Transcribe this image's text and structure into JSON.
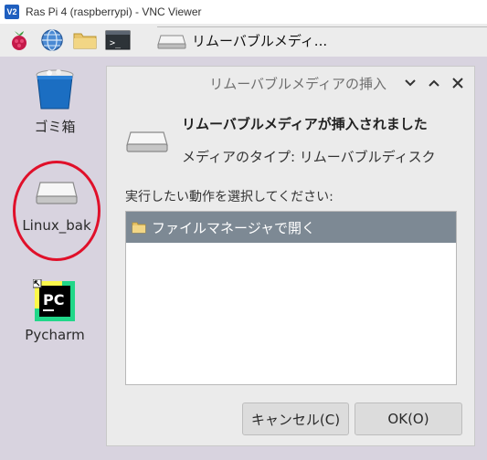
{
  "vnc": {
    "logo_text": "V2",
    "title": "Ras Pi 4 (raspberrypi) - VNC Viewer"
  },
  "taskbar": {
    "icons": [
      "raspberry-menu-icon",
      "web-browser-icon",
      "file-manager-icon",
      "terminal-icon"
    ],
    "window_label": "リムーバブルメディ..."
  },
  "desktop": {
    "trash_label": "ゴミ箱",
    "drive_label": "Linux_bak",
    "pycharm_label": "Pycharm",
    "pycharm_logo_text": "PC"
  },
  "dialog": {
    "title": "リムーバブルメディアの挿入",
    "heading": "リムーバブルメディアが挿入されました",
    "media_type": "メディアのタイプ:  リムーバブルディスク",
    "prompt": "実行したい動作を選択してください:",
    "actions": [
      {
        "label": "ファイルマネージャで開く",
        "selected": true
      }
    ],
    "cancel_label": "キャンセル(C)",
    "ok_label": "OK(O)"
  },
  "colors": {
    "selection": "#7d8994",
    "annotation_circle": "#e0102a",
    "desktop_bg": "#d8d3df"
  }
}
